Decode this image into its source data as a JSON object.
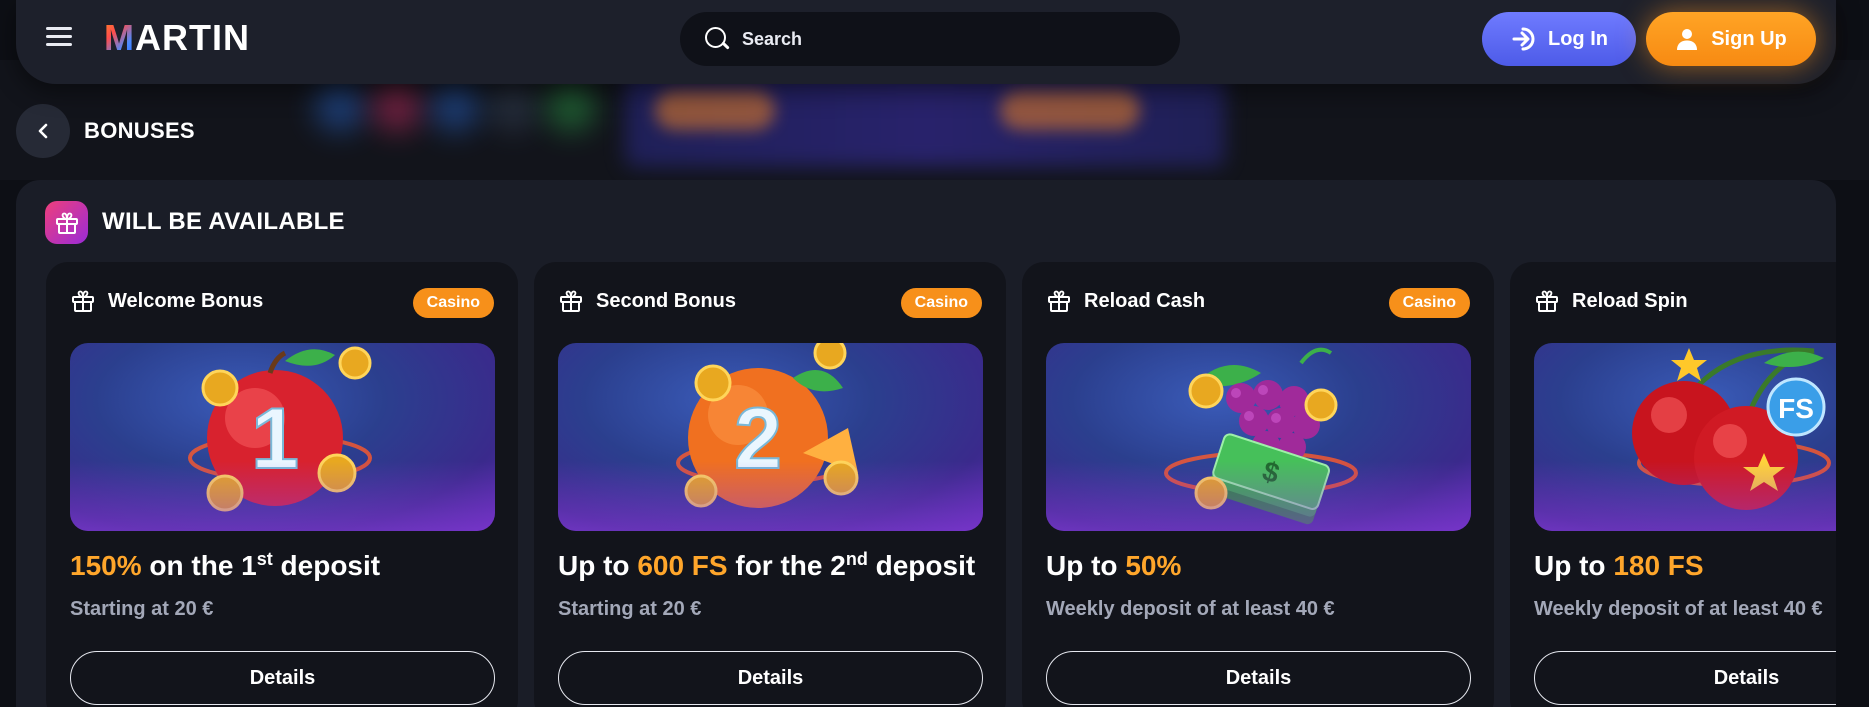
{
  "header": {
    "logo_m": "M",
    "logo_rest": "ARTIN",
    "search_placeholder": "Search",
    "login_label": "Log In",
    "signup_label": "Sign Up"
  },
  "breadcrumb": {
    "title": "BONUSES"
  },
  "section": {
    "title": "WILL BE AVAILABLE"
  },
  "cards": [
    {
      "title": "Welcome Bonus",
      "badge": "Casino",
      "offer": {
        "hl": "150%",
        "mid": " on the 1",
        "sup": "st",
        "end": " deposit"
      },
      "subtitle": "Starting at 20 €",
      "details_label": "Details",
      "artwork": "apple-number-1"
    },
    {
      "title": "Second Bonus",
      "badge": "Casino",
      "offer": {
        "pre": "Up to ",
        "hl": "600 FS",
        "mid": " for the 2",
        "sup": "nd",
        "end": " deposit"
      },
      "subtitle": "Starting at 20 €",
      "details_label": "Details",
      "artwork": "orange-number-2"
    },
    {
      "title": "Reload Cash",
      "badge": "Casino",
      "offer": {
        "pre": "Up to ",
        "hl": "50%"
      },
      "subtitle": "Weekly deposit of at least 40 €",
      "details_label": "Details",
      "artwork": "grapes-cash"
    },
    {
      "title": "Reload Spin",
      "offer": {
        "pre": "Up to ",
        "hl": "180 FS"
      },
      "subtitle": "Weekly deposit of at least 40 €",
      "details_label": "Details",
      "artwork": "cherries-fs",
      "artwork_text": "FS"
    }
  ],
  "colors": {
    "accent_orange": "#ffa62b",
    "badge": "#f7901a",
    "login": "#5b68f0",
    "signup": "#ff9a1f",
    "panel": "#1a1d27",
    "card": "#12141b"
  }
}
